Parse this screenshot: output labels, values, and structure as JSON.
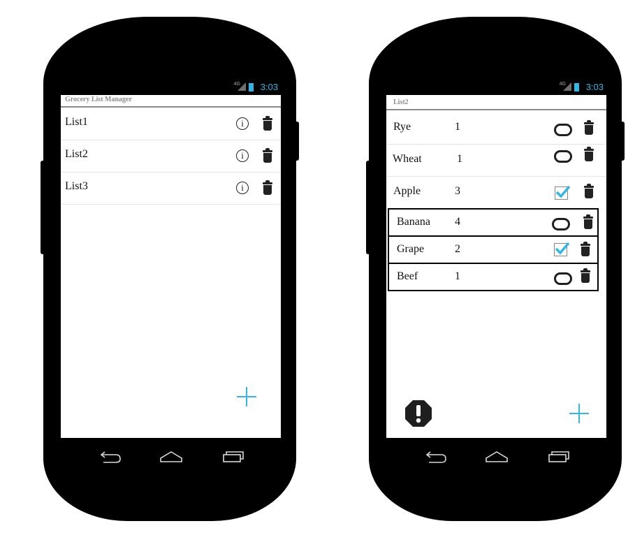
{
  "screen_left": {
    "status": {
      "network": "4G",
      "time": "3:03"
    },
    "app_title": "Grocery List Manager",
    "lists": [
      {
        "name": "List1"
      },
      {
        "name": "List2"
      },
      {
        "name": "List3"
      }
    ]
  },
  "screen_right": {
    "status": {
      "network": "4G",
      "time": "3:03"
    },
    "list_title": "List2",
    "items": [
      {
        "name": "Rye",
        "qty": "1",
        "checked": false
      },
      {
        "name": "Wheat",
        "qty": "1",
        "checked": false
      },
      {
        "name": "Apple",
        "qty": "3",
        "checked": true
      },
      {
        "name": "Banana",
        "qty": "4",
        "checked": false
      },
      {
        "name": "Grape",
        "qty": "2",
        "checked": true
      },
      {
        "name": "Beef",
        "qty": "1",
        "checked": false
      }
    ]
  },
  "colors": {
    "accent": "#33b5e5",
    "device": "#000000",
    "icon": "#222222"
  }
}
